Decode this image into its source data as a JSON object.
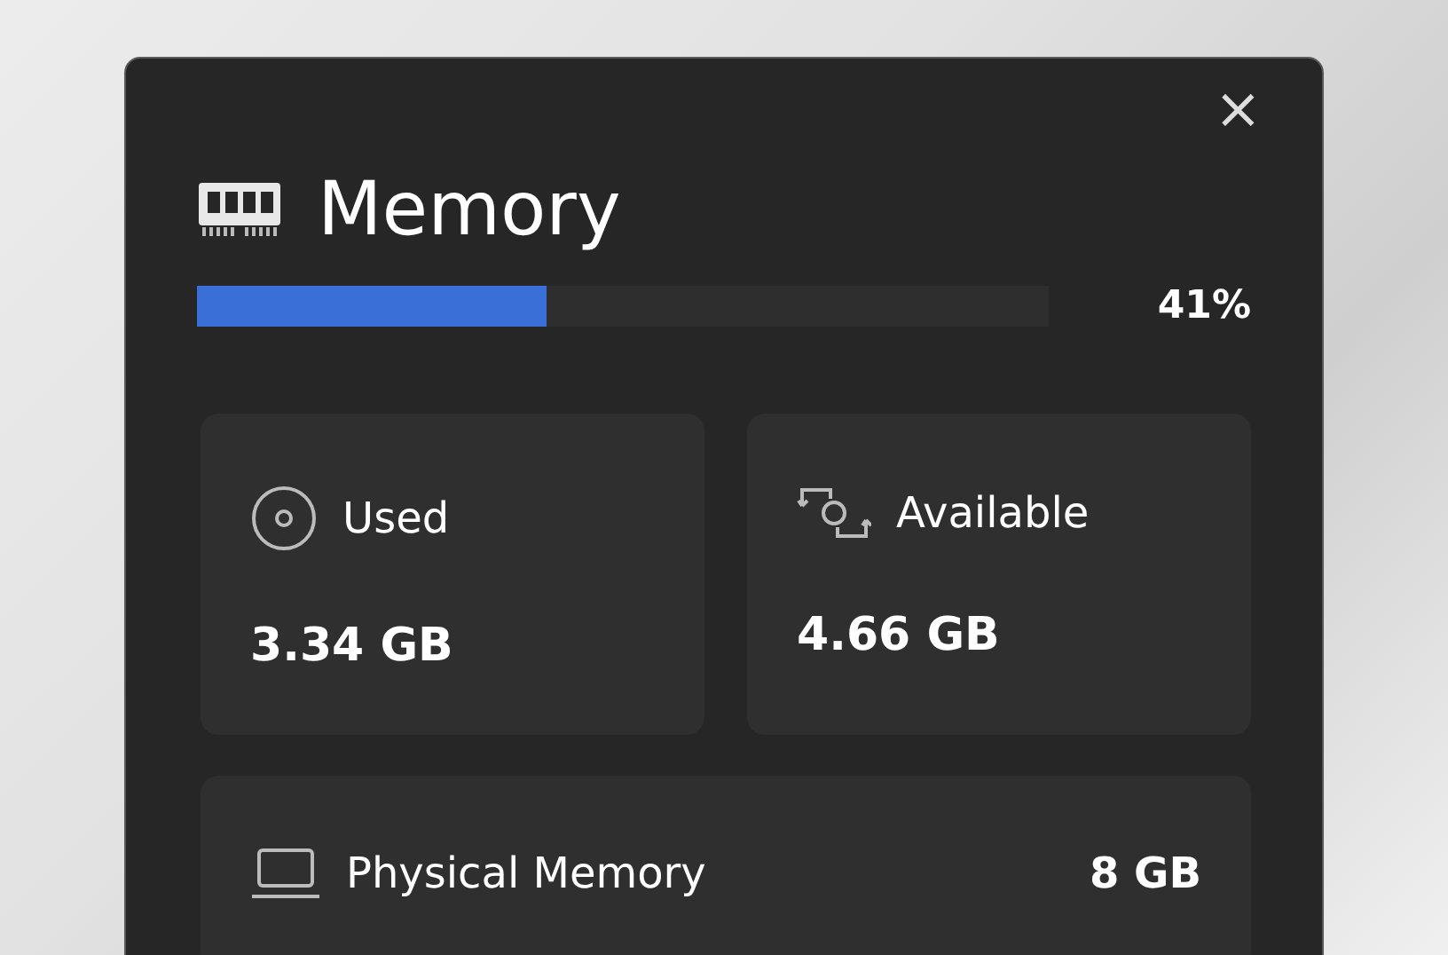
{
  "window": {
    "close": "×"
  },
  "header": {
    "title": "Memory"
  },
  "usage": {
    "level": 0.41,
    "reading": "41%"
  },
  "cards": [
    {
      "label": "Used",
      "value": "3.34 GB"
    },
    {
      "label": "Available",
      "value": "4.66 GB"
    }
  ],
  "details": [
    {
      "label": "Physical Memory",
      "value": "8 GB"
    }
  ]
}
